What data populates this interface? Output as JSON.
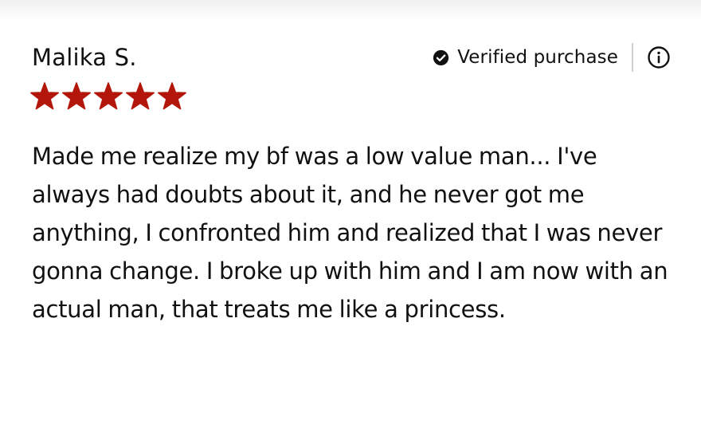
{
  "review": {
    "reviewer_name": "Malika S.",
    "verified_label": "Verified purchase",
    "rating": 5,
    "rating_max": 5,
    "body": "Made me realize my bf was a low value man... I've always had doubts about it, and he never got me anything, I confronted him and realized that I was never gonna change. I broke up with him and I am now with an actual man, that treats me like a princess."
  },
  "icons": {
    "verified": "check-circle-icon",
    "info": "info-icon",
    "star": "star-icon"
  },
  "colors": {
    "star": "#b3160b",
    "text": "#111111",
    "divider": "#d0d0d0",
    "background": "#ffffff"
  }
}
